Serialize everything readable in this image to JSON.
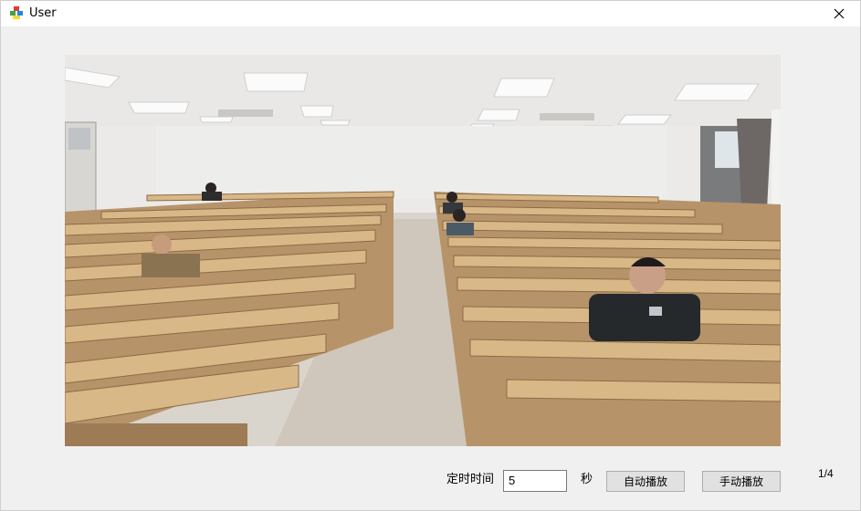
{
  "window": {
    "title": "User",
    "app_icon": "colored-cubes-icon",
    "close_icon": "close-icon"
  },
  "viewer": {
    "image_description_icon": "photo"
  },
  "controls": {
    "timer_label": "定时时间",
    "timer_value": "5",
    "seconds_label": "秒",
    "auto_play_label": "自动播放",
    "manual_play_label": "手动播放",
    "page_counter": "1/4"
  }
}
